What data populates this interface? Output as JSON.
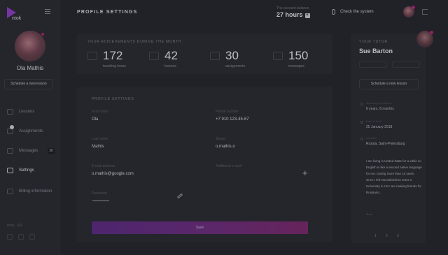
{
  "app": {
    "logo_text": "ntok"
  },
  "sidebar": {
    "user_name": "Ola Mathis",
    "schedule_button": "Schedule a new lesson",
    "items": [
      {
        "label": "Lessons",
        "icon": "lessons-icon"
      },
      {
        "label": "Assignments",
        "icon": "assignments-icon"
      },
      {
        "label": "Messages",
        "icon": "messages-icon",
        "badge": "30"
      },
      {
        "label": "Settings",
        "icon": "settings-icon",
        "active": true
      },
      {
        "label": "Billing information",
        "icon": "billing-icon"
      }
    ],
    "footer_text": "Help · EN"
  },
  "header": {
    "title": "PROFILE SETTINGS",
    "trainer_label": "The account balance",
    "trainer_value": "27 hours",
    "trainer_plus": "+",
    "check_system": "Check the system"
  },
  "achievements": {
    "title": "YOUR ACHIEVEMENTS DURING THE MONTH",
    "stats": [
      {
        "value": "172",
        "caption": "teaching hours"
      },
      {
        "value": "42",
        "caption": "lessons"
      },
      {
        "value": "30",
        "caption": "assignments"
      },
      {
        "value": "150",
        "caption": "messages"
      }
    ]
  },
  "profile": {
    "title": "PROFILE SETTINGS",
    "fields": {
      "first_name": {
        "label": "First name",
        "value": "Ola"
      },
      "phone": {
        "label": "Phone number",
        "value": "+7 910 123-45-67"
      },
      "last_name": {
        "label": "Last name",
        "value": "Mathis"
      },
      "skype": {
        "label": "Skype",
        "value": "o.mathis.o"
      },
      "email": {
        "label": "E-mail address",
        "value": "o.mathis@google.com"
      },
      "extra": {
        "label": "Additional e-mail"
      },
      "password": {
        "label": "Password"
      }
    },
    "add_plus": "+",
    "save_button": "Save"
  },
  "tutor": {
    "title": "YOUR TUTOR",
    "name": "Sue Barton",
    "schedule_button": "Schedule a new lesson",
    "experience_label": "Teaching experience",
    "experience_value": "6 years, 8 months",
    "birthday_label": "Date of birth",
    "birthday_value": "25 January 2018",
    "location_label": "Location",
    "location_value": "Russia, Saint-Petersburg",
    "about": "I am living in United State for a while so English is like a second native language for me. During more than 15 years since I left Novosibirsk to enter a University in US I am making friends for Russians...",
    "more": "More",
    "pages": [
      "1",
      "2",
      "3"
    ]
  },
  "colors": {
    "accent": "#8e3fc6",
    "badge": "#b2237a"
  }
}
